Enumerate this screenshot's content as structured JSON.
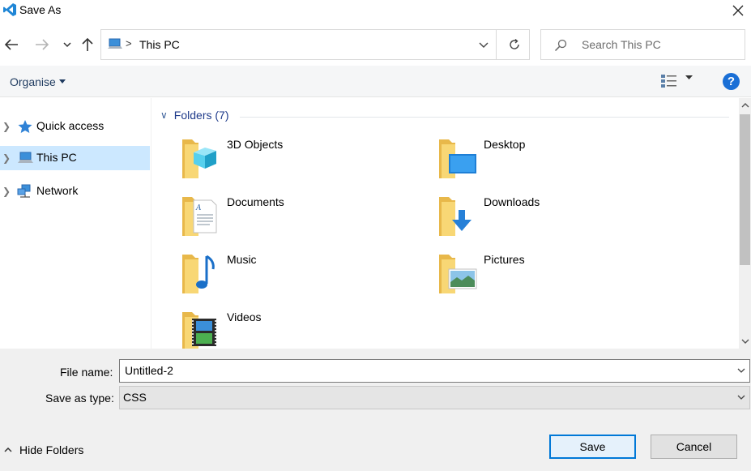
{
  "window": {
    "title": "Save As"
  },
  "address": {
    "location": "This PC"
  },
  "search": {
    "placeholder": "Search This PC"
  },
  "toolbar": {
    "organise_label": "Organise"
  },
  "sidebar": {
    "items": [
      {
        "label": "Quick access",
        "icon": "star-icon"
      },
      {
        "label": "This PC",
        "icon": "computer-icon"
      },
      {
        "label": "Network",
        "icon": "network-icon"
      }
    ]
  },
  "main": {
    "group_header": "Folders (7)",
    "folders": [
      {
        "label": "3D Objects",
        "icon": "3d-objects-folder-icon"
      },
      {
        "label": "Desktop",
        "icon": "desktop-folder-icon"
      },
      {
        "label": "Documents",
        "icon": "documents-folder-icon"
      },
      {
        "label": "Downloads",
        "icon": "downloads-folder-icon"
      },
      {
        "label": "Music",
        "icon": "music-folder-icon"
      },
      {
        "label": "Pictures",
        "icon": "pictures-folder-icon"
      },
      {
        "label": "Videos",
        "icon": "videos-folder-icon"
      }
    ]
  },
  "form": {
    "file_name_label": "File name:",
    "file_name_value": "Untitled-2",
    "save_type_label": "Save as type:",
    "save_type_value": "CSS"
  },
  "footer": {
    "hide_folders_label": "Hide Folders",
    "save_label": "Save",
    "cancel_label": "Cancel"
  },
  "colors": {
    "accent": "#0078d7",
    "selection": "#cce8ff",
    "folder": "#f8d775",
    "help": "#1a6fd6"
  }
}
